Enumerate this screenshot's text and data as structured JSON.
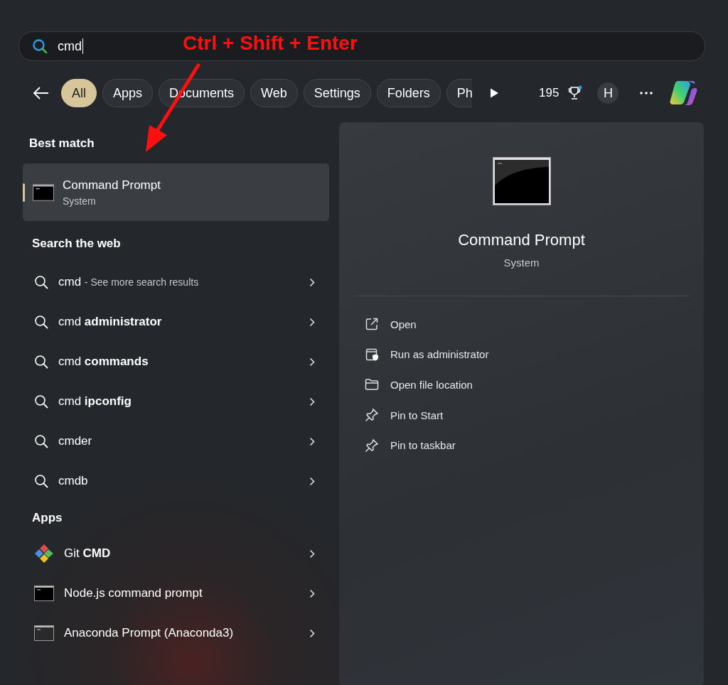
{
  "search": {
    "value": "cmd"
  },
  "annotation": {
    "text": "Ctrl + Shift + Enter"
  },
  "filters": [
    {
      "label": "All",
      "selected": true
    },
    {
      "label": "Apps",
      "selected": false
    },
    {
      "label": "Documents",
      "selected": false
    },
    {
      "label": "Web",
      "selected": false
    },
    {
      "label": "Settings",
      "selected": false
    },
    {
      "label": "Folders",
      "selected": false
    },
    {
      "label": "Ph",
      "selected": false
    }
  ],
  "points": "195",
  "avatar": "H",
  "best_match": {
    "heading": "Best match",
    "title": "Command Prompt",
    "subtitle": "System",
    "selected": true
  },
  "web": {
    "heading": "Search the web",
    "results": [
      {
        "text": "cmd",
        "hint": "- See more search results"
      },
      {
        "text": "cmd **administrator**"
      },
      {
        "text": "cmd **commands**"
      },
      {
        "text": "cmd **ipconfig**"
      },
      {
        "text": "cmder"
      },
      {
        "text": "cmdb"
      }
    ]
  },
  "apps": {
    "heading": "Apps",
    "items": [
      {
        "text": "Git **CMD**",
        "kind": "git"
      },
      {
        "text": "Node.js command prompt",
        "kind": "console"
      },
      {
        "text": "Anaconda Prompt (Anaconda3)",
        "kind": "console-grey"
      }
    ]
  },
  "detail": {
    "title": "Command Prompt",
    "subtitle": "System",
    "actions": [
      {
        "label": "Open",
        "kind": "open"
      },
      {
        "label": "Run as administrator",
        "kind": "admin"
      },
      {
        "label": "Open file location",
        "kind": "folder"
      },
      {
        "label": "Pin to Start",
        "kind": "pin"
      },
      {
        "label": "Pin to taskbar",
        "kind": "pin"
      }
    ]
  }
}
